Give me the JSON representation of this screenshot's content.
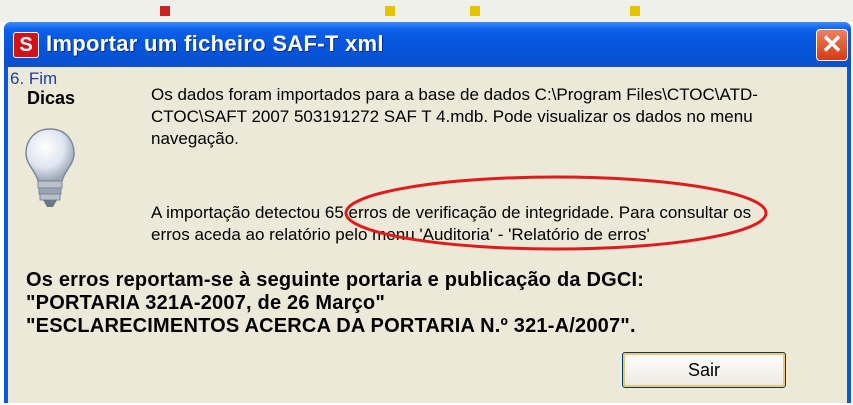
{
  "window": {
    "title": "Importar um ficheiro SAF-T xml",
    "app_icon_letter": "S",
    "close_glyph": "✕"
  },
  "sidebar": {
    "step": "6. Fim",
    "section": "Dicas",
    "icon": "lightbulb-icon"
  },
  "message": {
    "paragraph1": "Os dados foram importados para a base de dados C:\\Program Files\\CTOC\\ATD-CTOC\\SAFT 2007 503191272 SAF T 4.mdb. Pode visualizar os dados no menu navegação.",
    "paragraph2": "A importação detectou 65 erros de verificação de integridade. Para consultar os erros aceda ao relatório pelo menu 'Auditoria' - 'Relatório de erros'"
  },
  "notice": {
    "line1": "Os erros reportam-se à seguinte portaria e publicação da DGCI:",
    "line2": "\"PORTARIA 321A-2007, de 26 Março\"",
    "line3": "\"ESCLARECIMENTOS ACERCA DA PORTARIA N.º 321-A/2007\"."
  },
  "buttons": {
    "sair": "Sair"
  },
  "colors": {
    "titlebar": "#0655db",
    "client_bg": "#ece9d8",
    "annotation": "#e01b1b",
    "close": "#d43a14"
  }
}
